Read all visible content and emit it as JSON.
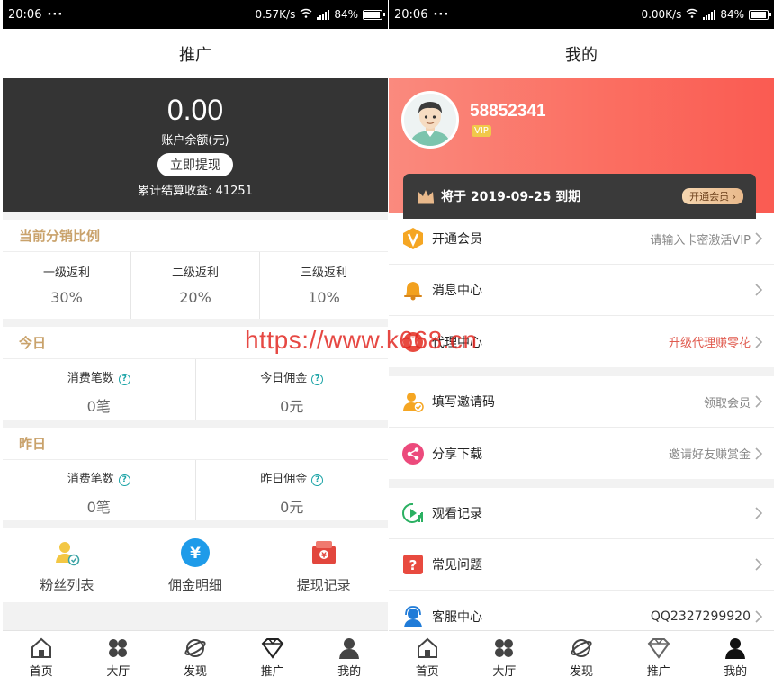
{
  "left": {
    "status": {
      "time": "20:06",
      "dots": "···",
      "speed": "0.57K/s",
      "battery": "84%"
    },
    "title": "推广",
    "balance": {
      "amount": "0.00",
      "label": "账户余额(元)",
      "withdraw_label": "立即提现",
      "total_label": "累计结算收益: 41251"
    },
    "ratio": {
      "title": "当前分销比例",
      "items": [
        {
          "label": "一级返利",
          "value": "30%"
        },
        {
          "label": "二级返利",
          "value": "20%"
        },
        {
          "label": "三级返利",
          "value": "10%"
        }
      ]
    },
    "today": {
      "title": "今日",
      "items": [
        {
          "label": "消费笔数",
          "value": "0笔"
        },
        {
          "label": "今日佣金",
          "value": "0元"
        }
      ]
    },
    "yesterday": {
      "title": "昨日",
      "items": [
        {
          "label": "消费笔数",
          "value": "0笔"
        },
        {
          "label": "昨日佣金",
          "value": "0元"
        }
      ]
    },
    "shortcuts": [
      {
        "label": "粉丝列表",
        "icon": "fans-icon"
      },
      {
        "label": "佣金明细",
        "icon": "yen-icon"
      },
      {
        "label": "提现记录",
        "icon": "wallet-icon"
      }
    ],
    "tabs": [
      {
        "label": "首页",
        "icon": "home-icon"
      },
      {
        "label": "大厅",
        "icon": "grid-icon"
      },
      {
        "label": "发现",
        "icon": "planet-icon"
      },
      {
        "label": "推广",
        "icon": "diamond-icon"
      },
      {
        "label": "我的",
        "icon": "user-icon"
      }
    ],
    "active_tab": "推广"
  },
  "right": {
    "status": {
      "time": "20:06",
      "dots": "···",
      "speed": "0.00K/s",
      "battery": "84%"
    },
    "title": "我的",
    "profile": {
      "uid": "58852341",
      "badge": "VIP"
    },
    "vip_card": {
      "expire": "将于 2019-09-25 到期",
      "button": "开通会员"
    },
    "menu_groups": [
      [
        {
          "label": "开通会员",
          "value": "请输入卡密激活VIP",
          "icon": "vip-v-icon",
          "value_style": "gray"
        },
        {
          "label": "消息中心",
          "value": "",
          "icon": "bell-icon",
          "value_style": "gray"
        },
        {
          "label": "代理中心",
          "value": "升级代理赚零花",
          "icon": "agent-icon",
          "value_style": "red"
        }
      ],
      [
        {
          "label": "填写邀请码",
          "value": "领取会员",
          "icon": "invite-user-icon",
          "value_style": "gray"
        },
        {
          "label": "分享下载",
          "value": "邀请好友赚赏金",
          "icon": "share-icon",
          "value_style": "gray"
        }
      ],
      [
        {
          "label": "观看记录",
          "value": "",
          "icon": "history-icon",
          "value_style": "gray"
        },
        {
          "label": "常见问题",
          "value": "",
          "icon": "question-icon",
          "value_style": "gray"
        },
        {
          "label": "客服中心",
          "value": "QQ2327299920",
          "icon": "service-icon",
          "value_style": "dark"
        }
      ]
    ],
    "tabs": [
      {
        "label": "首页",
        "icon": "home-icon"
      },
      {
        "label": "大厅",
        "icon": "grid-icon"
      },
      {
        "label": "发现",
        "icon": "planet-icon"
      },
      {
        "label": "推广",
        "icon": "diamond-icon"
      },
      {
        "label": "我的",
        "icon": "user-icon"
      }
    ],
    "active_tab": "我的"
  },
  "watermark": "https://www.k668.cn",
  "colors": {
    "gold": "#c9a26b",
    "accent_red": "#e05a4e",
    "dark_card": "#343434",
    "teal": "#1aa3a6",
    "profile_gradient": "#fa6f62"
  }
}
